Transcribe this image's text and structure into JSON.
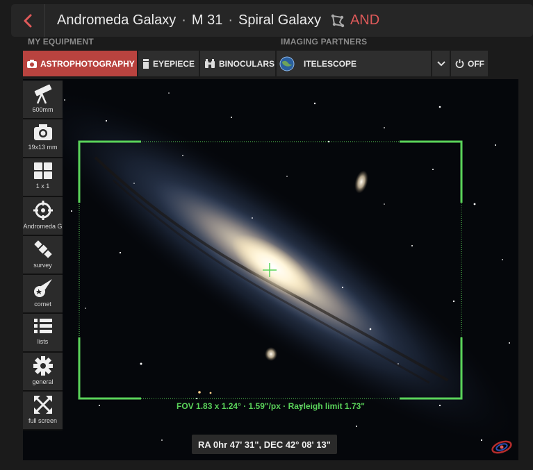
{
  "header": {
    "title_name": "Andromeda Galaxy",
    "title_catalog": "M 31",
    "title_type": "Spiral Galaxy",
    "separator": "·",
    "constellation": "AND",
    "back_icon": "chevron-left-icon",
    "constellation_icon": "constellation-icon"
  },
  "equipment": {
    "section_label": "MY EQUIPMENT",
    "buttons": [
      {
        "label": "ASTROPHOTOGRAPHY",
        "icon": "camera-icon",
        "active": true
      },
      {
        "label": "EYEPIECE",
        "icon": "eyepiece-icon",
        "active": false
      },
      {
        "label": "BINOCULARS",
        "icon": "binoculars-icon",
        "active": false
      }
    ]
  },
  "partners": {
    "section_label": "IMAGING PARTNERS",
    "selected": "ITELESCOPE",
    "off_label": "OFF"
  },
  "sidebar": {
    "items": [
      {
        "label": "600mm",
        "icon": "telescope-icon"
      },
      {
        "label": "19x13 mm",
        "icon": "camera-icon"
      },
      {
        "label": "1 x 1",
        "icon": "grid-icon"
      },
      {
        "label": "Andromeda G",
        "icon": "crosshair-icon"
      },
      {
        "label": "survey",
        "icon": "satellite-icon"
      },
      {
        "label": "comet",
        "icon": "comet-icon"
      },
      {
        "label": "lists",
        "icon": "list-icon"
      },
      {
        "label": "general",
        "icon": "gear-icon"
      },
      {
        "label": "full screen",
        "icon": "fullscreen-icon"
      }
    ]
  },
  "view": {
    "fov_text": "FOV 1.83 x 1.24° · 1.59\"/px · Rayleigh limit 1.73\"",
    "coordinates": "RA 0hr 47' 31\", DEC 42° 08' 13\"",
    "accent_color": "#5ad35a"
  },
  "colors": {
    "active": "#b9433f",
    "constellation": "#e05a5a"
  }
}
